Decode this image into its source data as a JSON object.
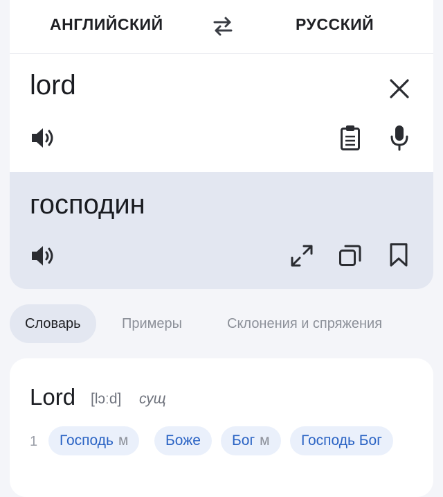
{
  "lang_bar": {
    "source_lang": "АНГЛИЙСКИЙ",
    "target_lang": "РУССКИЙ",
    "swap_icon": "swap-arrows-icon"
  },
  "input": {
    "text": "lord",
    "icons": [
      "close-icon",
      "speaker-icon",
      "clipboard-icon",
      "microphone-icon"
    ]
  },
  "output": {
    "text": "господин",
    "icons": [
      "speaker-icon",
      "expand-icon",
      "copy-icon",
      "bookmark-icon"
    ]
  },
  "tabs": [
    {
      "label": "Словарь",
      "active": true
    },
    {
      "label": "Примеры",
      "active": false
    },
    {
      "label": "Склонения и спряжения",
      "active": false
    }
  ],
  "dictionary": {
    "headword": "Lord",
    "transcription": "[lɔːd]",
    "part_of_speech": "сущ",
    "senses": [
      {
        "number": "1",
        "translations": [
          {
            "word": "Господь",
            "gender": "м"
          },
          {
            "word": "Боже",
            "gender": ""
          },
          {
            "word": "Бог",
            "gender": "м"
          },
          {
            "word": "Господь Бог",
            "gender": ""
          }
        ]
      }
    ]
  },
  "colors": {
    "background": "#f4f5f9",
    "card": "#ffffff",
    "output_bg": "#e3e7f1",
    "chip_text": "#2a63c4",
    "chip_bg": "#eaf0fb",
    "muted_text": "#8c9099"
  }
}
